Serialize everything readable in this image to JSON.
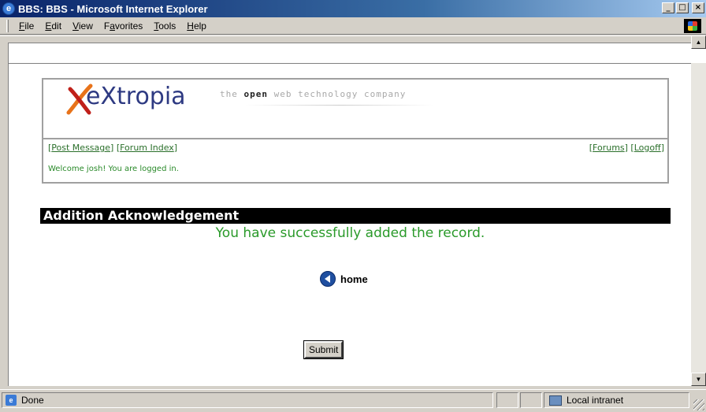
{
  "window": {
    "title": "BBS: BBS - Microsoft Internet Explorer"
  },
  "menu": {
    "items": [
      {
        "label": "File",
        "accel": "F",
        "rest": "ile"
      },
      {
        "label": "Edit",
        "accel": "E",
        "rest": "dit"
      },
      {
        "label": "View",
        "accel": "V",
        "rest": "iew"
      },
      {
        "label": "Favorites",
        "accel": "",
        "pre": "F",
        "accel2": "a",
        "rest": "vorites"
      },
      {
        "label": "Tools",
        "accel": "T",
        "rest": "ools"
      },
      {
        "label": "Help",
        "accel": "H",
        "rest": "elp"
      }
    ]
  },
  "header": {
    "logo_text": "eXtropia",
    "tagline_pre": "the ",
    "tagline_bold": "open",
    "tagline_post": " web technology company"
  },
  "nav": {
    "post_message": "Post Message",
    "forum_index": "Forum Index",
    "forums": "Forums",
    "logoff": "Logoff"
  },
  "welcome": "Welcome josh! You are logged in.",
  "section": {
    "title": "Addition Acknowledgement"
  },
  "message": "You have successfully added the record.",
  "home_link": "home",
  "submit_label": "Submit",
  "status": {
    "text": "Done",
    "zone": "Local intranet"
  }
}
